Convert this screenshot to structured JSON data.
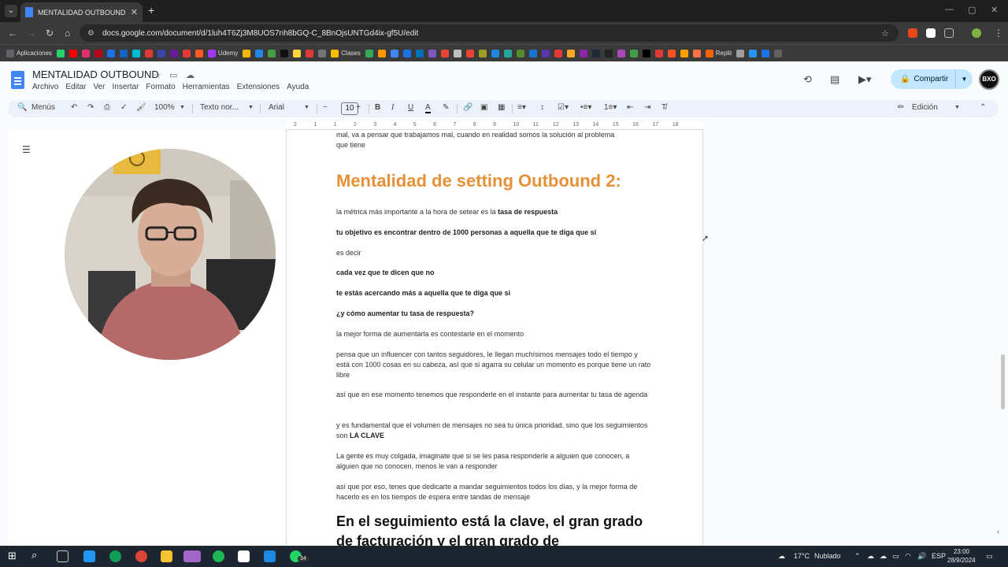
{
  "browser": {
    "tab_title": "MENTALIDAD OUTBOUND - Do",
    "url": "docs.google.com/document/d/1luh4T6Zj3M8UOS7nh8bGQ-C_8BnOjsUNTGd4ix-gf5U/edit"
  },
  "bookmarks": [
    {
      "label": "Aplicaciones",
      "icon": "apps-grid-icon",
      "color": "#5f6368"
    },
    {
      "label": "",
      "icon": "whatsapp-icon",
      "color": "#25d366"
    },
    {
      "label": "",
      "icon": "youtube-icon",
      "color": "#ff0000"
    },
    {
      "label": "",
      "icon": "instagram-icon",
      "color": "#e1306c"
    },
    {
      "label": "",
      "icon": "pinterest-icon",
      "color": "#b7081b"
    },
    {
      "label": "",
      "icon": "bookmark-icon",
      "color": "#1a73e8"
    },
    {
      "label": "",
      "icon": "bookmark-icon",
      "color": "#1565c0"
    },
    {
      "label": "",
      "icon": "bookmark-icon",
      "color": "#00bcd4"
    },
    {
      "label": "",
      "icon": "star-icon",
      "color": "#e53935"
    },
    {
      "label": "",
      "icon": "bookmark-icon",
      "color": "#3949ab"
    },
    {
      "label": "",
      "icon": "bookmark-icon",
      "color": "#6a1b9a"
    },
    {
      "label": "",
      "icon": "bookmark-icon",
      "color": "#e53935"
    },
    {
      "label": "",
      "icon": "bookmark-icon",
      "color": "#ff5722"
    },
    {
      "label": "Udemy",
      "icon": "udemy-icon",
      "color": "#a435f0"
    },
    {
      "label": "",
      "icon": "binance-icon",
      "color": "#f0b90b"
    },
    {
      "label": "",
      "icon": "bookmark-icon",
      "color": "#1e88e5"
    },
    {
      "label": "",
      "icon": "bookmark-icon",
      "color": "#43a047"
    },
    {
      "label": "",
      "icon": "bookmark-icon",
      "color": "#111111"
    },
    {
      "label": "",
      "icon": "bookmark-icon",
      "color": "#fdd835"
    },
    {
      "label": "",
      "icon": "bookmark-icon",
      "color": "#e53935"
    },
    {
      "label": "",
      "icon": "bookmark-icon",
      "color": "#757575"
    },
    {
      "label": "Clases",
      "icon": "classroom-icon",
      "color": "#fbbc04"
    },
    {
      "label": "",
      "icon": "bookmark-icon",
      "color": "#34a853"
    },
    {
      "label": "",
      "icon": "bookmark-icon",
      "color": "#ff9800"
    },
    {
      "label": "",
      "icon": "bookmark-icon",
      "color": "#4285f4"
    },
    {
      "label": "",
      "icon": "bookmark-icon",
      "color": "#1a73e8"
    },
    {
      "label": "",
      "icon": "paypal-icon",
      "color": "#0070ba"
    },
    {
      "label": "",
      "icon": "bookmark-icon",
      "color": "#7e57c2"
    },
    {
      "label": "",
      "icon": "google-icon",
      "color": "#ea4335"
    },
    {
      "label": "",
      "icon": "bookmark-icon",
      "color": "#c0c0c0"
    },
    {
      "label": "",
      "icon": "google-icon",
      "color": "#ea4335"
    },
    {
      "label": "",
      "icon": "bookmark-icon",
      "color": "#9e9d24"
    },
    {
      "label": "",
      "icon": "bookmark-icon",
      "color": "#1e88e5"
    },
    {
      "label": "",
      "icon": "bookmark-icon",
      "color": "#26a69a"
    },
    {
      "label": "",
      "icon": "bookmark-icon",
      "color": "#558b2f"
    },
    {
      "label": "",
      "icon": "bookmark-icon",
      "color": "#1976d2"
    },
    {
      "label": "",
      "icon": "bookmark-icon",
      "color": "#5e35b1"
    },
    {
      "label": "",
      "icon": "bookmark-icon",
      "color": "#e53935"
    },
    {
      "label": "",
      "icon": "bookmark-icon",
      "color": "#f9a825"
    },
    {
      "label": "",
      "icon": "bookmark-icon",
      "color": "#8e24aa"
    },
    {
      "label": "",
      "icon": "steam-icon",
      "color": "#1b2838"
    },
    {
      "label": "",
      "icon": "bookmark-icon",
      "color": "#212121"
    },
    {
      "label": "",
      "icon": "bookmark-icon",
      "color": "#ab47bc"
    },
    {
      "label": "",
      "icon": "bookmark-icon",
      "color": "#43a047"
    },
    {
      "label": "",
      "icon": "x-twitter-icon",
      "color": "#000000"
    },
    {
      "label": "",
      "icon": "bookmark-icon",
      "color": "#e53935"
    },
    {
      "label": "",
      "icon": "bookmark-icon",
      "color": "#f4511e"
    },
    {
      "label": "",
      "icon": "bookmark-icon",
      "color": "#ffa000"
    },
    {
      "label": "",
      "icon": "bookmark-icon",
      "color": "#ff7043"
    },
    {
      "label": "Replit",
      "icon": "replit-icon",
      "color": "#f26207"
    },
    {
      "label": "",
      "icon": "bookmark-icon",
      "color": "#9e9e9e"
    },
    {
      "label": "",
      "icon": "bookmark-icon",
      "color": "#2196f3"
    },
    {
      "label": "",
      "icon": "bookmark-icon",
      "color": "#1a73e8"
    },
    {
      "label": "",
      "icon": "bookmark-icon",
      "color": "#616161"
    }
  ],
  "docs": {
    "title": "MENTALIDAD OUTBOUND",
    "menu": [
      "Archivo",
      "Editar",
      "Ver",
      "Insertar",
      "Formato",
      "Herramientas",
      "Extensiones",
      "Ayuda"
    ],
    "share_label": "Compartir",
    "avatar_text": "BXO",
    "toolbar": {
      "menus_label": "Menús",
      "zoom": "100%",
      "style": "Texto nor...",
      "font": "Arial",
      "font_size": "10",
      "mode": "Edición"
    },
    "ruler_ticks": [
      "2",
      "1",
      "1",
      "2",
      "3",
      "4",
      "5",
      "6",
      "7",
      "8",
      "9",
      "10",
      "11",
      "12",
      "13",
      "14",
      "15",
      "16",
      "17",
      "18"
    ]
  },
  "document": {
    "top_cut_line1": "mal, va a pensar que trabajamos mal, cuando en realidad somos la solución al problema",
    "top_cut_line2": "que tiene",
    "heading": "Mentalidad de setting Outbound 2:",
    "p1_a": "la métrica más importante a la hora de setear es la ",
    "p1_b": "tasa de respuesta",
    "p2": "tu objetivo es encontrar dentro de 1000 personas a aquella que te diga que si",
    "p3": "es decir",
    "p4": "cada vez que te dicen que no",
    "p5": "te estás acercando más a aquella que te diga que si",
    "p6": "¿y cómo aumentar tu tasa de respuesta?",
    "p7": "la mejor forma de aumentarla es contestarle en el momento",
    "p8": "pensa que un influencer con tantos seguidores, le llegan muchísimos mensajes todo el tiempo y está con 1000 cosas en su cabeza, así que si agarra su celular un momento es porque tiene un rato libre",
    "p9": "así que en ese momento tenemos que responderle en el instante para aumentar tu tasa de agenda",
    "p10_a": "y es fundamental que el volumen de mensajes no sea tu única prioridad, sino que los seguimientos son ",
    "p10_b": "LA CLAVE",
    "p11": "La gente es muy colgada, imaginate que si se les pasa responderle a alguien que conocen, a alguien que no conocen, menos le van a responder",
    "p12": "así que por eso, tenes que dedicarte a mandar seguimientos todos los días, y la mejor forma de hacerlo es en los tiempos de espera entre tandas de mensaje",
    "heading2": "En el seguimiento está la clave, el gran grado de facturación y el gran grado de"
  },
  "taskbar": {
    "weather_temp": "17°C",
    "weather_desc": "Nublado",
    "language": "ESP",
    "time": "23:00",
    "date": "28/9/2024",
    "whatsapp_badge": "34"
  }
}
